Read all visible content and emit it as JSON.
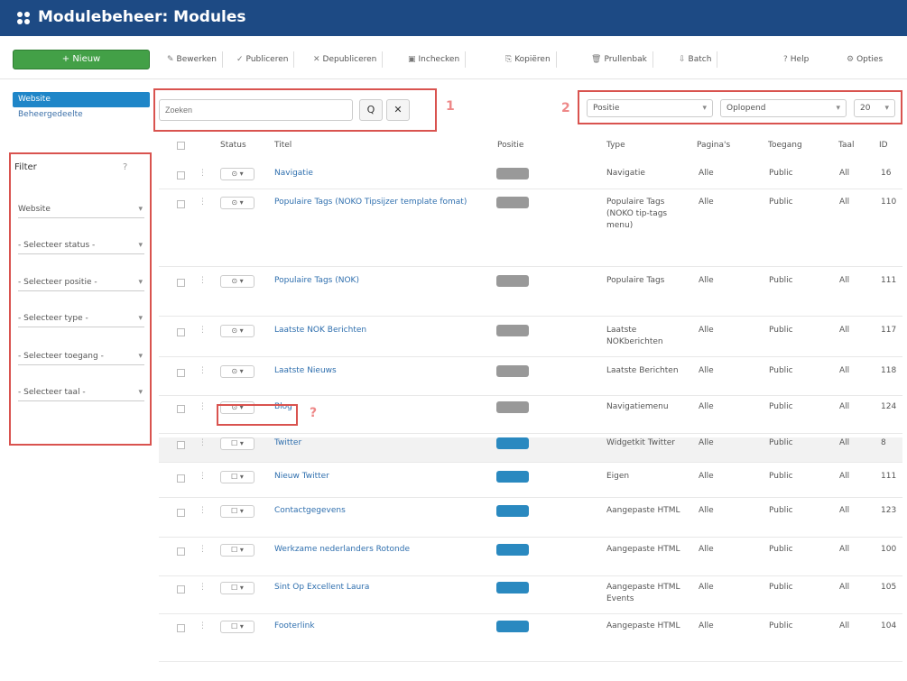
{
  "header": {
    "title": "Modulebeheer: Modules"
  },
  "toolbar": {
    "new": "Nieuw",
    "buttons": [
      "Bewerken",
      "Publiceren",
      "Depubliceren",
      "Inchecken",
      "Kopiëren",
      "Prullenbak",
      "Batch",
      "Help",
      "Opties"
    ]
  },
  "subnav": {
    "active": "Website",
    "item": "Beheergedeelte"
  },
  "search": {
    "placeholder": "Zoeken",
    "search_btn": "Q",
    "clear_btn": "✕",
    "marker1": "1",
    "marker2": "2"
  },
  "top_filters": {
    "position": "Positie",
    "ordering": "Oplopend",
    "limit": "20"
  },
  "filters": {
    "title": "Filter",
    "q": "?",
    "items": [
      "Website",
      "- Selecteer status -",
      "- Selecteer positie -",
      "- Selecteer type -",
      "- Selecteer toegang -",
      "- Selecteer taal -"
    ]
  },
  "columns": [
    "Status",
    "Titel",
    "Positie",
    "Type",
    "Pagina's",
    "Toegang",
    "Taal",
    "ID"
  ],
  "rows": [
    {
      "title": "Navigatie",
      "sub": "",
      "position": "",
      "type": "Navigatie",
      "pages": "Alle",
      "access": "Public",
      "lang": "All",
      "id": "16",
      "badge": "grey"
    },
    {
      "title": "Populaire Tags (NOKO Tipsijzer template fomat)",
      "sub": "",
      "position": "",
      "type": "Populaire Tags (NOKO tip-tags menu)",
      "pages": "Alle",
      "access": "Public",
      "lang": "All",
      "id": "110",
      "badge": "grey"
    },
    {
      "title": "Populaire Tags (NOK)",
      "sub": "",
      "position": "",
      "type": "Populaire Tags",
      "pages": "Alle",
      "access": "Public",
      "lang": "All",
      "id": "111",
      "badge": "grey"
    },
    {
      "title": "Laatste NOK Berichten",
      "sub": "",
      "position": "",
      "type": "Laatste NOKberichten",
      "pages": "Alle",
      "access": "Public",
      "lang": "All",
      "id": "117",
      "badge": "grey"
    },
    {
      "title": "Laatste Nieuws",
      "sub": "",
      "position": "",
      "type": "Laatste Berichten",
      "pages": "Alle",
      "access": "Public",
      "lang": "All",
      "id": "118",
      "badge": "grey"
    },
    {
      "title": "Blog",
      "sub": "",
      "position": "",
      "type": "Navigatiemenu",
      "pages": "Alle",
      "access": "Public",
      "lang": "All",
      "id": "124",
      "badge": "grey"
    },
    {
      "title": "Twitter",
      "sub": "",
      "position": "",
      "type": "Widgetkit Twitter",
      "pages": "Alle",
      "access": "Public",
      "lang": "All",
      "id": "8",
      "badge": "blue"
    },
    {
      "title": "Nieuw Twitter",
      "sub": "",
      "position": "",
      "type": "Eigen",
      "pages": "Alle",
      "access": "Public",
      "lang": "All",
      "id": "111",
      "badge": "blue"
    },
    {
      "title": "Contactgegevens",
      "sub": "",
      "position": "",
      "type": "Aangepaste HTML",
      "pages": "Alle",
      "access": "Public",
      "lang": "All",
      "id": "123",
      "badge": "blue"
    },
    {
      "title": "Werkzame nederlanders Rotonde",
      "sub": "",
      "position": "",
      "type": "Aangepaste HTML",
      "pages": "Alle",
      "access": "Public",
      "lang": "All",
      "id": "100",
      "badge": "blue"
    },
    {
      "title": "Sint Op Excellent Laura",
      "sub": "",
      "position": "",
      "type": "Aangepaste HTML Events",
      "pages": "Alle",
      "access": "Public",
      "lang": "All",
      "id": "105",
      "badge": "blue"
    },
    {
      "title": "Footerlink",
      "sub": "",
      "position": "",
      "type": "Aangepaste HTML",
      "pages": "Alle",
      "access": "Public",
      "lang": "All",
      "id": "104",
      "badge": "blue"
    }
  ]
}
